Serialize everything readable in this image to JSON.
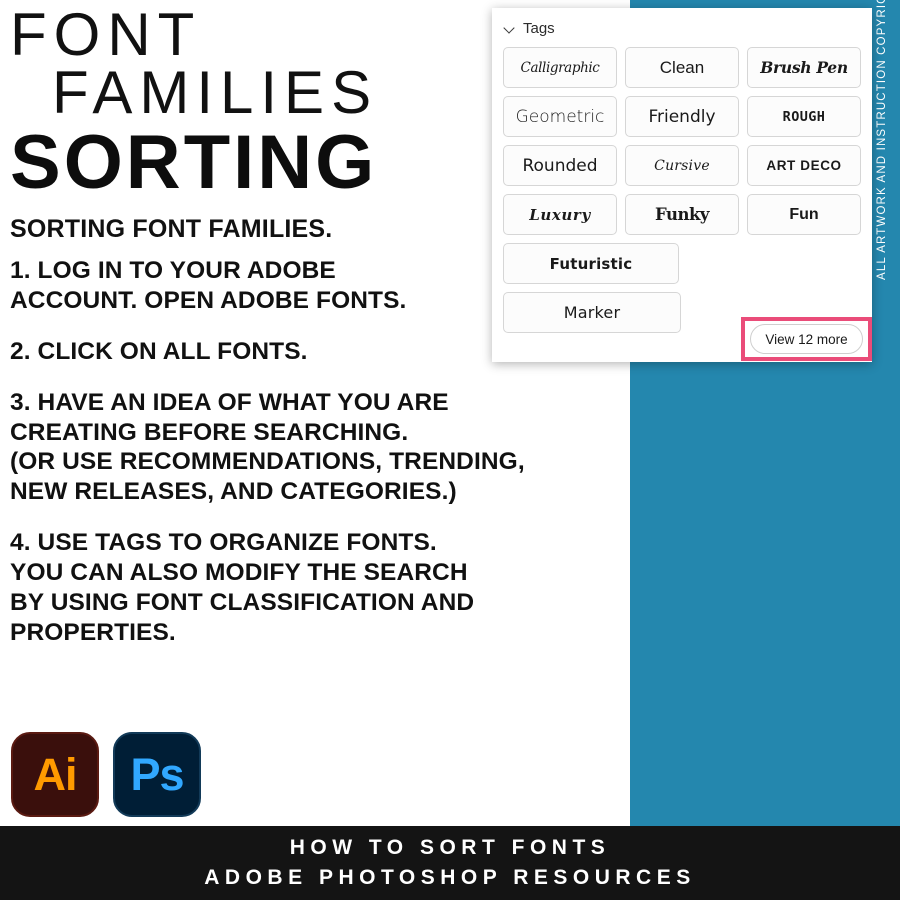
{
  "headline": {
    "line1": "FONT",
    "line2": "FAMILIES",
    "line3": "SORTING",
    "subtitle": "SORTING FONT FAMILIES."
  },
  "steps": [
    "1. LOG IN TO YOUR ADOBE\nACCOUNT. OPEN ADOBE FONTS.",
    "2. CLICK ON ALL FONTS.",
    "3. HAVE AN IDEA OF WHAT YOU ARE\nCREATING BEFORE SEARCHING.\n(OR USE RECOMMENDATIONS, TRENDING,\nNEW RELEASES, AND CATEGORIES.)",
    "4. USE TAGS TO ORGANIZE FONTS.\nYOU CAN ALSO MODIFY THE SEARCH\nBY USING FONT CLASSIFICATION AND\nPROPERTIES."
  ],
  "apps": [
    {
      "label": "Ai",
      "name": "adobe-illustrator-icon",
      "color": "#ff9a00",
      "background": "#3a0f0c"
    },
    {
      "label": "Ps",
      "name": "adobe-photoshop-icon",
      "color": "#31a8ff",
      "background": "#001e36"
    }
  ],
  "tags_panel": {
    "header": "Tags",
    "collapse_icon": "chevron-down-icon",
    "tags": [
      "Calligraphic",
      "Clean",
      "Brush Pen",
      "Geometric",
      "Friendly",
      "ROUGH",
      "Rounded",
      "Cursive",
      "ART DECO",
      "Luxury",
      "Funky",
      "Fun",
      "Futuristic",
      "Marker"
    ],
    "view_more_label": "View 12 more",
    "highlight_color": "#ea4c79"
  },
  "copyright": "ALL ARTWORK AND INSTRUCTION COPYRIGHTED © JASON SECREST",
  "footer": {
    "line1": "HOW TO SORT FONTS",
    "line2": "ADOBE PHOTOSHOP RESOURCES"
  },
  "colors": {
    "teal": "#2487ae",
    "footer_bg": "#141414",
    "text": "#111111"
  }
}
